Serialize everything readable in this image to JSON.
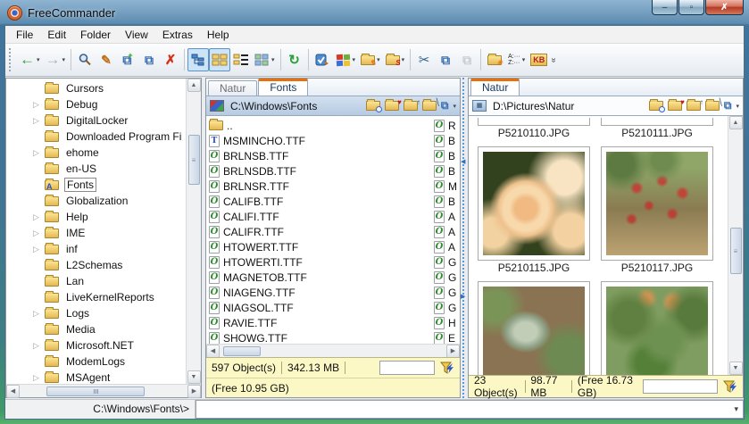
{
  "window": {
    "title": "FreeCommander",
    "controls": {
      "minimize": "–",
      "maximize": "▫",
      "close": "✗"
    }
  },
  "menu": {
    "items": [
      "File",
      "Edit",
      "Folder",
      "View",
      "Extras",
      "Help"
    ]
  },
  "toolbar": {
    "glyphs": {
      "back": "←",
      "forward": "→",
      "edit": "✎",
      "copy_add": "⧉",
      "paste_new": "⧉",
      "delete": "✗",
      "refresh": "↻",
      "cut": "✂",
      "copy": "⧉",
      "paste": "⧉",
      "dropdown": "▾",
      "plus": "+",
      "check": "✓",
      "s_folder": "S",
      "new_folder": "✳",
      "pencil": "✎",
      "sort_a": "A:···",
      "sort_z": "Z:···",
      "kb": "KB",
      "overflow": "»"
    }
  },
  "icons": {
    "fonts_badge": "A",
    "heart": "♥",
    "up": "↑",
    "diag": "╲",
    "copy_path": "⧉"
  },
  "tree": {
    "arrow": "▷",
    "items": [
      {
        "label": "Cursors",
        "expandable": false
      },
      {
        "label": "Debug",
        "expandable": true
      },
      {
        "label": "DigitalLocker",
        "expandable": true
      },
      {
        "label": "Downloaded Program Fi",
        "expandable": false
      },
      {
        "label": "ehome",
        "expandable": true
      },
      {
        "label": "en-US",
        "expandable": false
      },
      {
        "label": "Fonts",
        "expandable": false,
        "selected": true
      },
      {
        "label": "Globalization",
        "expandable": false
      },
      {
        "label": "Help",
        "expandable": true
      },
      {
        "label": "IME",
        "expandable": true
      },
      {
        "label": "inf",
        "expandable": true
      },
      {
        "label": "L2Schemas",
        "expandable": false
      },
      {
        "label": "Lan",
        "expandable": false
      },
      {
        "label": "LiveKernelReports",
        "expandable": false
      },
      {
        "label": "Logs",
        "expandable": true
      },
      {
        "label": "Media",
        "expandable": false
      },
      {
        "label": "Microsoft.NET",
        "expandable": true
      },
      {
        "label": "ModemLogs",
        "expandable": false
      },
      {
        "label": "MSAgent",
        "expandable": true
      }
    ]
  },
  "middle_panel": {
    "tabs": [
      {
        "label": "Natur",
        "active": false
      },
      {
        "label": "Fonts",
        "active": true
      }
    ],
    "path": "C:\\Windows\\Fonts",
    "files": [
      {
        "name": "..",
        "kind": "folder",
        "badge": ""
      },
      {
        "name": "MSMINCHO.TTF",
        "kind": "tt",
        "badge": "T"
      },
      {
        "name": "BRLNSB.TTF",
        "kind": "otf",
        "badge": "O"
      },
      {
        "name": "BRLNSDB.TTF",
        "kind": "otf",
        "badge": "O"
      },
      {
        "name": "BRLNSR.TTF",
        "kind": "otf",
        "badge": "O"
      },
      {
        "name": "CALIFB.TTF",
        "kind": "otf",
        "badge": "O"
      },
      {
        "name": "CALIFI.TTF",
        "kind": "otf",
        "badge": "O"
      },
      {
        "name": "CALIFR.TTF",
        "kind": "otf",
        "badge": "O"
      },
      {
        "name": "HTOWERT.TTF",
        "kind": "otf",
        "badge": "O"
      },
      {
        "name": "HTOWERTI.TTF",
        "kind": "otf",
        "badge": "O"
      },
      {
        "name": "MAGNETOB.TTF",
        "kind": "otf",
        "badge": "O"
      },
      {
        "name": "NIAGENG.TTF",
        "kind": "otf",
        "badge": "O"
      },
      {
        "name": "NIAGSOL.TTF",
        "kind": "otf",
        "badge": "O"
      },
      {
        "name": "RAVIE.TTF",
        "kind": "otf",
        "badge": "O"
      },
      {
        "name": "SHOWG.TTF",
        "kind": "otf",
        "badge": "O"
      }
    ],
    "partial_column": {
      "badge": "O",
      "letters": [
        "R",
        "B",
        "B",
        "B",
        "M",
        "B",
        "A",
        "A",
        "A",
        "G",
        "G",
        "G",
        "G",
        "H",
        "E"
      ]
    },
    "status": {
      "objects": "597 Object(s)",
      "size": "342.13 MB",
      "free": "(Free 10.95 GB)",
      "filter_value": ""
    }
  },
  "right_panel": {
    "tabs": [
      {
        "label": "Natur",
        "active": true
      }
    ],
    "path": "D:\\Pictures\\Natur",
    "thumbnails": [
      {
        "name": "P5210110.JPG"
      },
      {
        "name": "P5210111.JPG"
      },
      {
        "name": "P5210115.JPG"
      },
      {
        "name": "P5210117.JPG"
      },
      {
        "name": ""
      },
      {
        "name": ""
      }
    ],
    "status": {
      "objects": "23 Object(s)",
      "size": "98.77 MB",
      "free": "(Free 16.73 GB)",
      "filter_value": ""
    }
  },
  "command_bar": {
    "prompt": "C:\\Windows\\Fonts\\>",
    "value": ""
  }
}
